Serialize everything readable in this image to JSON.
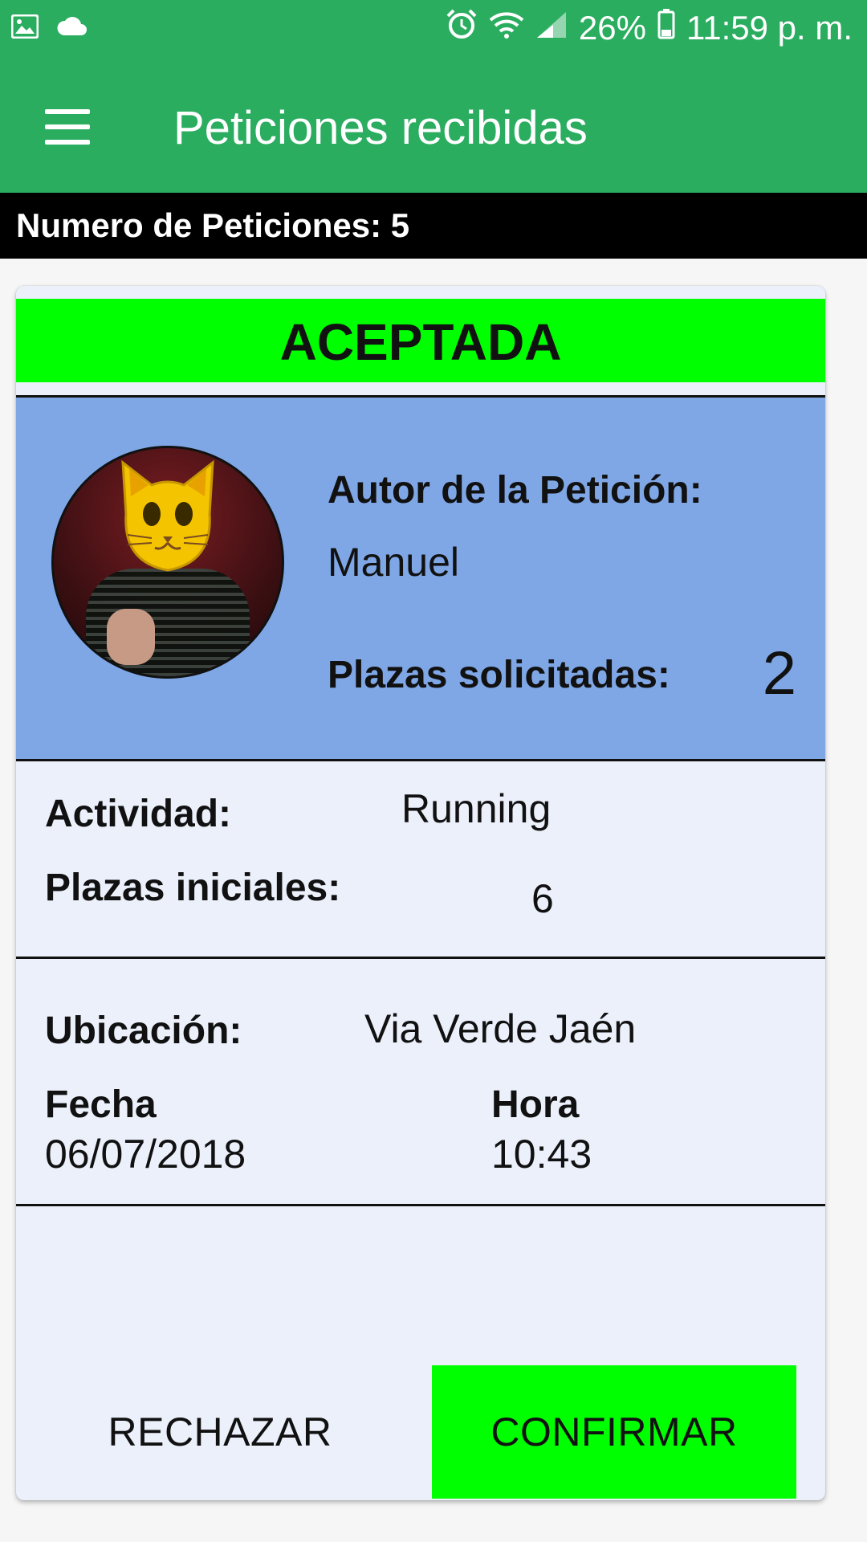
{
  "status_bar": {
    "battery": "26%",
    "time": "11:59 p. m.",
    "icons": [
      "image-icon",
      "cloud-icon",
      "alarm-icon",
      "wifi-icon",
      "signal-icon",
      "battery-icon"
    ]
  },
  "appbar": {
    "title": "Peticiones recibidas",
    "menu_icon": "hamburger-menu-icon"
  },
  "count": {
    "text": "Numero de Peticiones: 5"
  },
  "request": {
    "status": "ACEPTADA",
    "status_color": "#00ff00",
    "author_label": "Autor de la Petición:",
    "author_name": "Manuel",
    "seats_requested_label": "Plazas solicitadas:",
    "seats_requested": "2",
    "activity_label": "Actividad:",
    "activity": "Running",
    "initial_seats_label": "Plazas iniciales:",
    "initial_seats": "6",
    "location_label": "Ubicación:",
    "location": "Via Verde Jaén",
    "date_label": "Fecha",
    "date": "06/07/2018",
    "time_label": "Hora",
    "time": "10:43"
  },
  "actions": {
    "reject_label": "RECHAZAR",
    "confirm_label": "CONFIRMAR"
  },
  "colors": {
    "primary": "#2bad60",
    "author_bg": "#7fa7e6",
    "card_bg": "#ebf0fb",
    "accent_green": "#00ff00"
  }
}
